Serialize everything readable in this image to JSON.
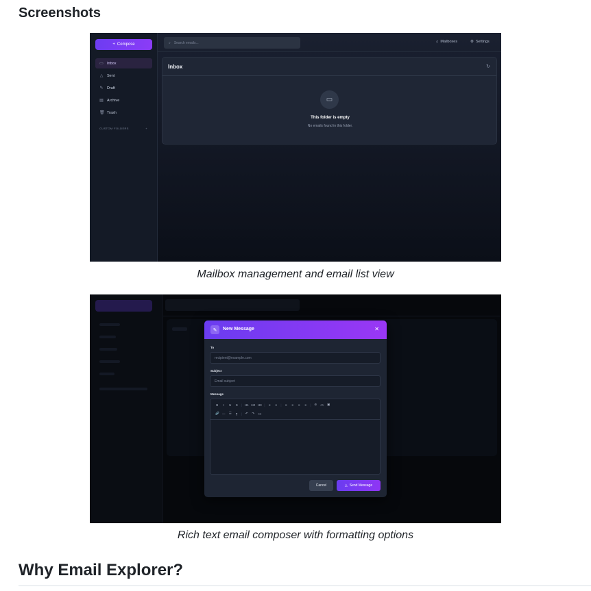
{
  "headings": {
    "screenshots": "Screenshots",
    "why": "Why Email Explorer?"
  },
  "captions": {
    "first": "Mailbox management and email list view",
    "second": "Rich text email composer with formatting options"
  },
  "app": {
    "compose_label": "Compose",
    "search_placeholder": "Search emails...",
    "top_links": [
      {
        "label": "Mailboxes",
        "icon": "mailbox-icon"
      },
      {
        "label": "Settings",
        "icon": "gear-icon"
      }
    ],
    "nav": [
      {
        "label": "Inbox",
        "icon": "inbox-icon",
        "active": true
      },
      {
        "label": "Sent",
        "icon": "send-icon",
        "active": false
      },
      {
        "label": "Draft",
        "icon": "edit-icon",
        "active": false
      },
      {
        "label": "Archive",
        "icon": "archive-icon",
        "active": false
      },
      {
        "label": "Trash",
        "icon": "trash-icon",
        "active": false
      }
    ],
    "custom_folders_label": "CUSTOM FOLDERS",
    "folder_title": "Inbox",
    "empty_title": "This folder is empty",
    "empty_subtitle": "No emails found in this folder."
  },
  "composer": {
    "title": "New Message",
    "to_label": "To",
    "to_placeholder": "recipient@example.com",
    "subject_label": "Subject",
    "subject_placeholder": "Email subject",
    "message_label": "Message",
    "toolbar_row1": [
      "B",
      "I",
      "U",
      "S",
      "|",
      "H1",
      "H2",
      "H3",
      "|",
      "≡",
      "≡",
      "|",
      "≡",
      "≡",
      "≡",
      "≡",
      "|",
      "⊘",
      "<>",
      "▣"
    ],
    "toolbar_row2": [
      "🔗",
      "—",
      "☰",
      "¶",
      "|",
      "↶",
      "↷",
      "<>"
    ],
    "cancel_label": "Cancel",
    "send_label": "Send Message"
  },
  "colors": {
    "accent": "#7c3aed",
    "app_bg": "#141a26"
  }
}
